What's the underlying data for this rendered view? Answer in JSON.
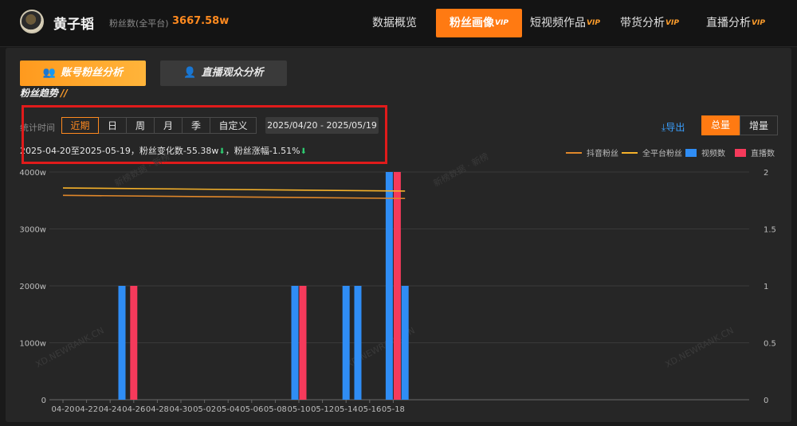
{
  "header": {
    "username": "黄子韬",
    "fans_label": "粉丝数(全平台)",
    "fans_value": "3667.58w",
    "nav": [
      {
        "label": "数据概览",
        "vip": ""
      },
      {
        "label": "粉丝画像",
        "vip": "VIP",
        "active": true
      },
      {
        "label": "短视频作品",
        "vip": "VIP"
      },
      {
        "label": "带货分析",
        "vip": "VIP"
      },
      {
        "label": "直播分析",
        "vip": "VIP"
      }
    ]
  },
  "tabs": {
    "fans": "账号粉丝分析",
    "live": "直播观众分析"
  },
  "section_title": "粉丝趋势",
  "filters": {
    "time_label": "统计时间",
    "periods": [
      "近期",
      "日",
      "周",
      "月",
      "季",
      "自定义"
    ],
    "active_period": "近期",
    "date_range": "2025/04/20  -  2025/05/19"
  },
  "summary": {
    "text": "2025-04-20至2025-05-19，粉丝变化数-55.38w",
    "sep": "，粉丝涨幅-1.51%"
  },
  "actions": {
    "export": "导出",
    "total": "总量",
    "increment": "增量"
  },
  "legend": {
    "douyin": "抖音粉丝",
    "all": "全平台粉丝",
    "videos": "视频数",
    "lives": "直播数"
  },
  "watermark": "新榜数据 · 新榜",
  "watermark2": "XD.NEWRANK.CN",
  "colors": {
    "accent": "#ff7a12",
    "douyin_line": "#e0872a",
    "all_line": "#f5b12a",
    "videos": "#2f8df5",
    "lives": "#f53a5b"
  },
  "chart_data": {
    "type": "bar",
    "x_ticks": [
      "04-20",
      "04-22",
      "04-24",
      "04-26",
      "04-28",
      "04-30",
      "05-02",
      "05-04",
      "05-06",
      "05-08",
      "05-10",
      "05-12",
      "05-14",
      "05-16",
      "05-18"
    ],
    "y_left_ticks": [
      "0",
      "1000w",
      "2000w",
      "3000w",
      "4000w"
    ],
    "y_right_ticks": [
      "0",
      "0.5",
      "1",
      "1.5",
      "2"
    ],
    "ylim_left": [
      0,
      4000
    ],
    "ylim_right": [
      0,
      2
    ],
    "dates": [
      "04-20",
      "04-21",
      "04-22",
      "04-23",
      "04-24",
      "04-25",
      "04-26",
      "04-27",
      "04-28",
      "04-29",
      "04-30",
      "05-01",
      "05-02",
      "05-03",
      "05-04",
      "05-05",
      "05-06",
      "05-07",
      "05-08",
      "05-09",
      "05-10",
      "05-11",
      "05-12",
      "05-13",
      "05-14",
      "05-15",
      "05-16",
      "05-17",
      "05-18",
      "05-19"
    ],
    "series": [
      {
        "name": "抖音粉丝",
        "type": "line",
        "axis": "left",
        "start": 3590,
        "end": 3535
      },
      {
        "name": "全平台粉丝",
        "type": "line",
        "axis": "left",
        "start": 3720,
        "end": 3665
      },
      {
        "name": "视频数",
        "type": "bar",
        "axis": "right",
        "values": {
          "04-25": 1,
          "05-10": 1,
          "05-14": 1,
          "05-15": 1,
          "05-18": 2,
          "05-19": 1
        }
      },
      {
        "name": "直播数",
        "type": "bar",
        "axis": "right",
        "values": {
          "04-26": 1,
          "05-10": 1,
          "05-18": 2
        }
      }
    ]
  }
}
